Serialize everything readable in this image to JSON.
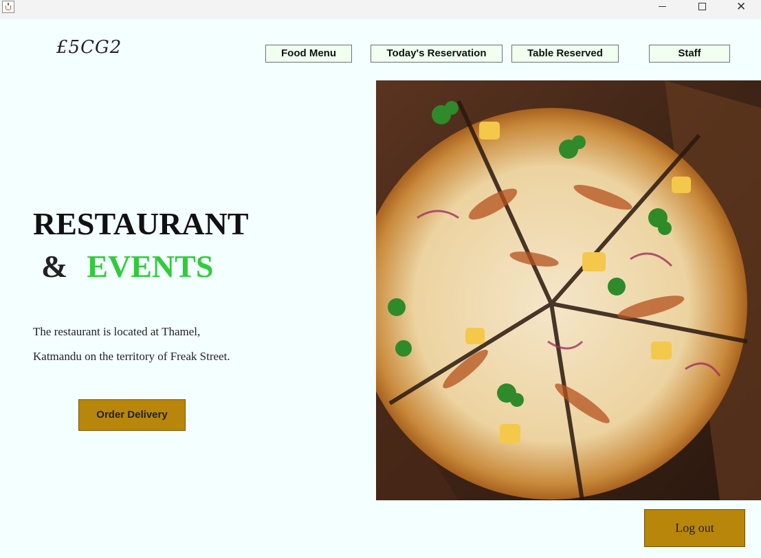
{
  "window": {
    "controls": {
      "minimize": "minimize",
      "maximize": "maximize",
      "close": "close"
    }
  },
  "header": {
    "logo": "£5CG2",
    "nav": [
      {
        "label": "Food Menu"
      },
      {
        "label": "Today's Reservation"
      },
      {
        "label": "Table Reserved"
      },
      {
        "label": "Staff"
      }
    ]
  },
  "hero_text": {
    "line1": "RESTAURANT",
    "ampersand": "&",
    "events": "EVENTS",
    "description_line1": "The restaurant is located at Thamel,",
    "description_line2": "Katmandu on the territory of Freak Street."
  },
  "actions": {
    "order_delivery": "Order Delivery",
    "logout": "Log out"
  },
  "colors": {
    "background": "#f4ffff",
    "accent_gold": "#b8860b",
    "events_green": "#2fcc3a",
    "nav_button_bg": "#f0fff0"
  },
  "image": {
    "icon": "pizza-image"
  }
}
